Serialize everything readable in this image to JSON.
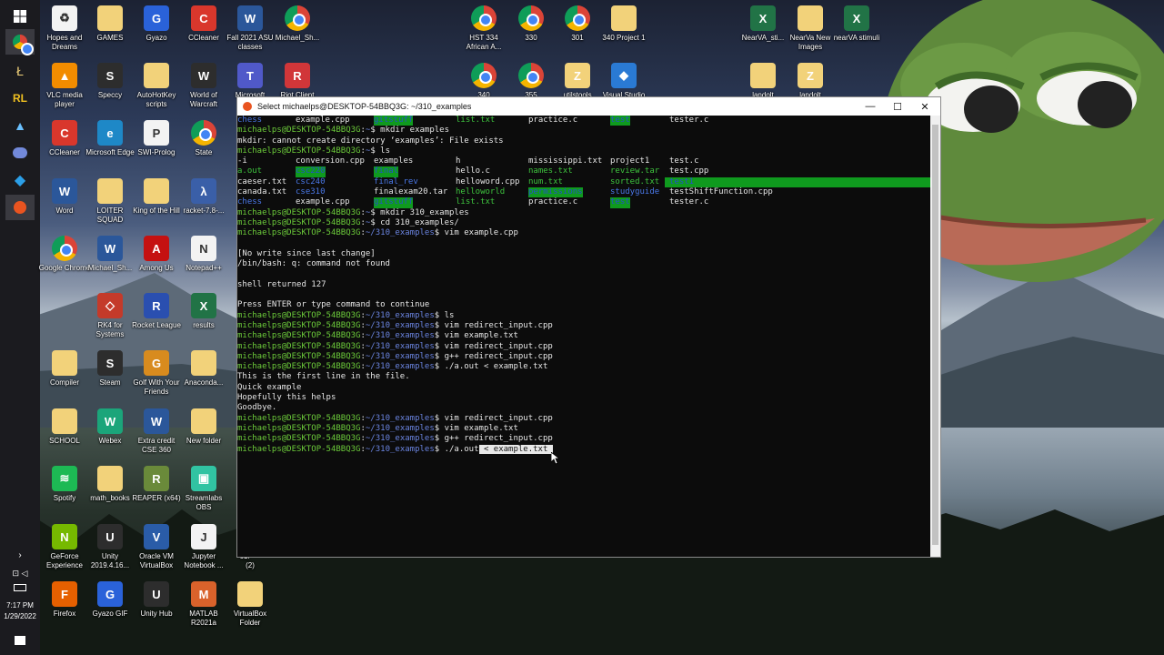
{
  "window": {
    "title": "Select michaelps@DESKTOP-54BBQ3G: ~/310_examples",
    "minimize_glyph": "—",
    "maximize_glyph": "☐",
    "close_glyph": "✕"
  },
  "taskbar": {
    "time": "7:17 PM",
    "date": "1/29/2022",
    "icons": [
      "windows-icon",
      "chrome-icon",
      "files-icon",
      "latex-icon",
      "ide-icon",
      "discord-icon",
      "vscode-icon",
      "ubuntu-icon"
    ]
  },
  "desktop_icons": [
    {
      "label": "Hopes and Dreams",
      "type": "recycle-bin"
    },
    {
      "label": "GAMES",
      "type": "folder"
    },
    {
      "label": "Gyazo",
      "type": "gyazo"
    },
    {
      "label": "CCleaner",
      "type": "ccleaner"
    },
    {
      "label": "Fall 2021 ASU classes",
      "type": "word"
    },
    {
      "label": "Michael_Sh...",
      "type": "chrome"
    },
    {
      "label": "HST 334 African A...",
      "type": "chrome"
    },
    {
      "label": "330",
      "type": "chrome"
    },
    {
      "label": "301",
      "type": "chrome"
    },
    {
      "label": "340 Project 1",
      "type": "folder"
    },
    {
      "label": "NearVA_sti...",
      "type": "excel"
    },
    {
      "label": "NearVa New Images",
      "type": "folder"
    },
    {
      "label": "nearVA stimuli",
      "type": "excel"
    },
    {
      "label": "VLC media player",
      "type": "vlc"
    },
    {
      "label": "Speccy",
      "type": "speccy"
    },
    {
      "label": "AutoHotKey scripts",
      "type": "folder"
    },
    {
      "label": "World of Warcraft",
      "type": "wow"
    },
    {
      "label": "Microsoft",
      "type": "teams"
    },
    {
      "label": "Riot Client",
      "type": "riot"
    },
    {
      "label": "340",
      "type": "chrome"
    },
    {
      "label": "355",
      "type": "chrome"
    },
    {
      "label": "utilstools",
      "type": "zip"
    },
    {
      "label": "Visual Studio",
      "type": "vs"
    },
    {
      "label": "landolt",
      "type": "folder"
    },
    {
      "label": "landolt",
      "type": "zip"
    },
    {
      "label": "CCleaner",
      "type": "ccleaner"
    },
    {
      "label": "Microsoft Edge",
      "type": "edge"
    },
    {
      "label": "SWI-Prolog",
      "type": "prolog"
    },
    {
      "label": "State",
      "type": "chrome"
    },
    {
      "label": "Word",
      "type": "word"
    },
    {
      "label": "LOITER SQUAD",
      "type": "folder"
    },
    {
      "label": "King of the Hill",
      "type": "folder"
    },
    {
      "label": "racket-7.8-...",
      "type": "racket"
    },
    {
      "label": "Google Chrome",
      "type": "chrome"
    },
    {
      "label": "Michael_Sh...",
      "type": "word"
    },
    {
      "label": "Among Us",
      "type": "amongus"
    },
    {
      "label": "Notepad++",
      "type": "notepad"
    },
    {
      "label": "RK4 for Systems",
      "type": "rk4"
    },
    {
      "label": "Rocket League",
      "type": "rocket"
    },
    {
      "label": "results",
      "type": "excel"
    },
    {
      "label": "Compiler",
      "type": "folder"
    },
    {
      "label": "Steam",
      "type": "steam"
    },
    {
      "label": "Golf With Your Friends",
      "type": "golf"
    },
    {
      "label": "Anaconda...",
      "type": "folder"
    },
    {
      "label": "SCHOOL",
      "type": "folder"
    },
    {
      "label": "Webex",
      "type": "webex"
    },
    {
      "label": "Extra credit CSE 360",
      "type": "word"
    },
    {
      "label": "New folder",
      "type": "folder"
    },
    {
      "label": "Spotify",
      "type": "spotify"
    },
    {
      "label": "math_books",
      "type": "folder"
    },
    {
      "label": "REAPER (x64)",
      "type": "reaper"
    },
    {
      "label": "Streamlabs OBS",
      "type": "streamlabs"
    },
    {
      "label": "GeForce Experience",
      "type": "geforce"
    },
    {
      "label": "Unity 2019.4.16...",
      "type": "unity"
    },
    {
      "label": "Oracle VM VirtualBox",
      "type": "virtualbox"
    },
    {
      "label": "Jupyter Notebook ...",
      "type": "jupyter"
    },
    {
      "label": "Firefox",
      "type": "firefox"
    },
    {
      "label": "Gyazo GIF",
      "type": "gyazo"
    },
    {
      "label": "Unity Hub",
      "type": "unity"
    },
    {
      "label": "MATLAB R2021a",
      "type": "matlab"
    },
    {
      "label": "VirtualBox Folder",
      "type": "folder"
    }
  ],
  "stray_labels": {
    "a": "61.",
    "b": "(2)"
  },
  "terminal": {
    "user_host": "michaelps@DESKTOP-54BBQ3G",
    "ls1": [
      "chess",
      "example.cpp",
      "gitstuff",
      "list.txt",
      "practice.c",
      "test",
      "tester.c"
    ],
    "cmd_mkdir_examples": "mkdir examples",
    "err_mkdir": "mkdir: cannot create directory ‘examples’: File exists",
    "cmd_ls": "ls",
    "ls_row1": [
      "-i",
      "conversion.cpp",
      "examples",
      "h",
      "mississippi.txt",
      "project1",
      "test.c"
    ],
    "ls_row2": [
      "a.out",
      "csc220",
      "final",
      "hello.c",
      "names.txt",
      "review.tar",
      "test.cpp"
    ],
    "ls_row3": [
      "caeser.txt",
      "csc240",
      "final_rev",
      "helloword.cpp",
      "num.txt",
      "sorted.txt",
      "test1"
    ],
    "ls_row4": [
      "canada.txt",
      "cse310",
      "finalexam20.tar",
      "helloworld",
      "permissions",
      "studyguide",
      "testShiftFunction.cpp"
    ],
    "ls_row5": [
      "chess",
      "example.cpp",
      "gitstuff",
      "list.txt",
      "practice.c",
      "test",
      "tester.c"
    ],
    "cmd_mkdir_310": "mkdir 310_examples",
    "cmd_cd": "cd 310_examples/",
    "path": "~/310_examples",
    "path_home": "~",
    "cmd_vim_example": "vim example.cpp",
    "vim_msg1": "[No write since last change]",
    "vim_msg2": "/bin/bash: q: command not found",
    "vim_msg3": "shell returned 127",
    "vim_msg4": "Press ENTER or type command to continue",
    "cmd_vim_redirect": "vim redirect_input.cpp",
    "cmd_vim_example_txt": "vim example.txt",
    "cmd_gpp": "g++ redirect_input.cpp",
    "cmd_run": "./a.out < example.txt",
    "out1": "This is the first line in the file.",
    "out2": "Quick example",
    "out3": "Hopefully this helps",
    "out4": "Goodbye.",
    "cmd_run_prefix": "./a.out",
    "cmd_run_selected": " < example.txt "
  }
}
